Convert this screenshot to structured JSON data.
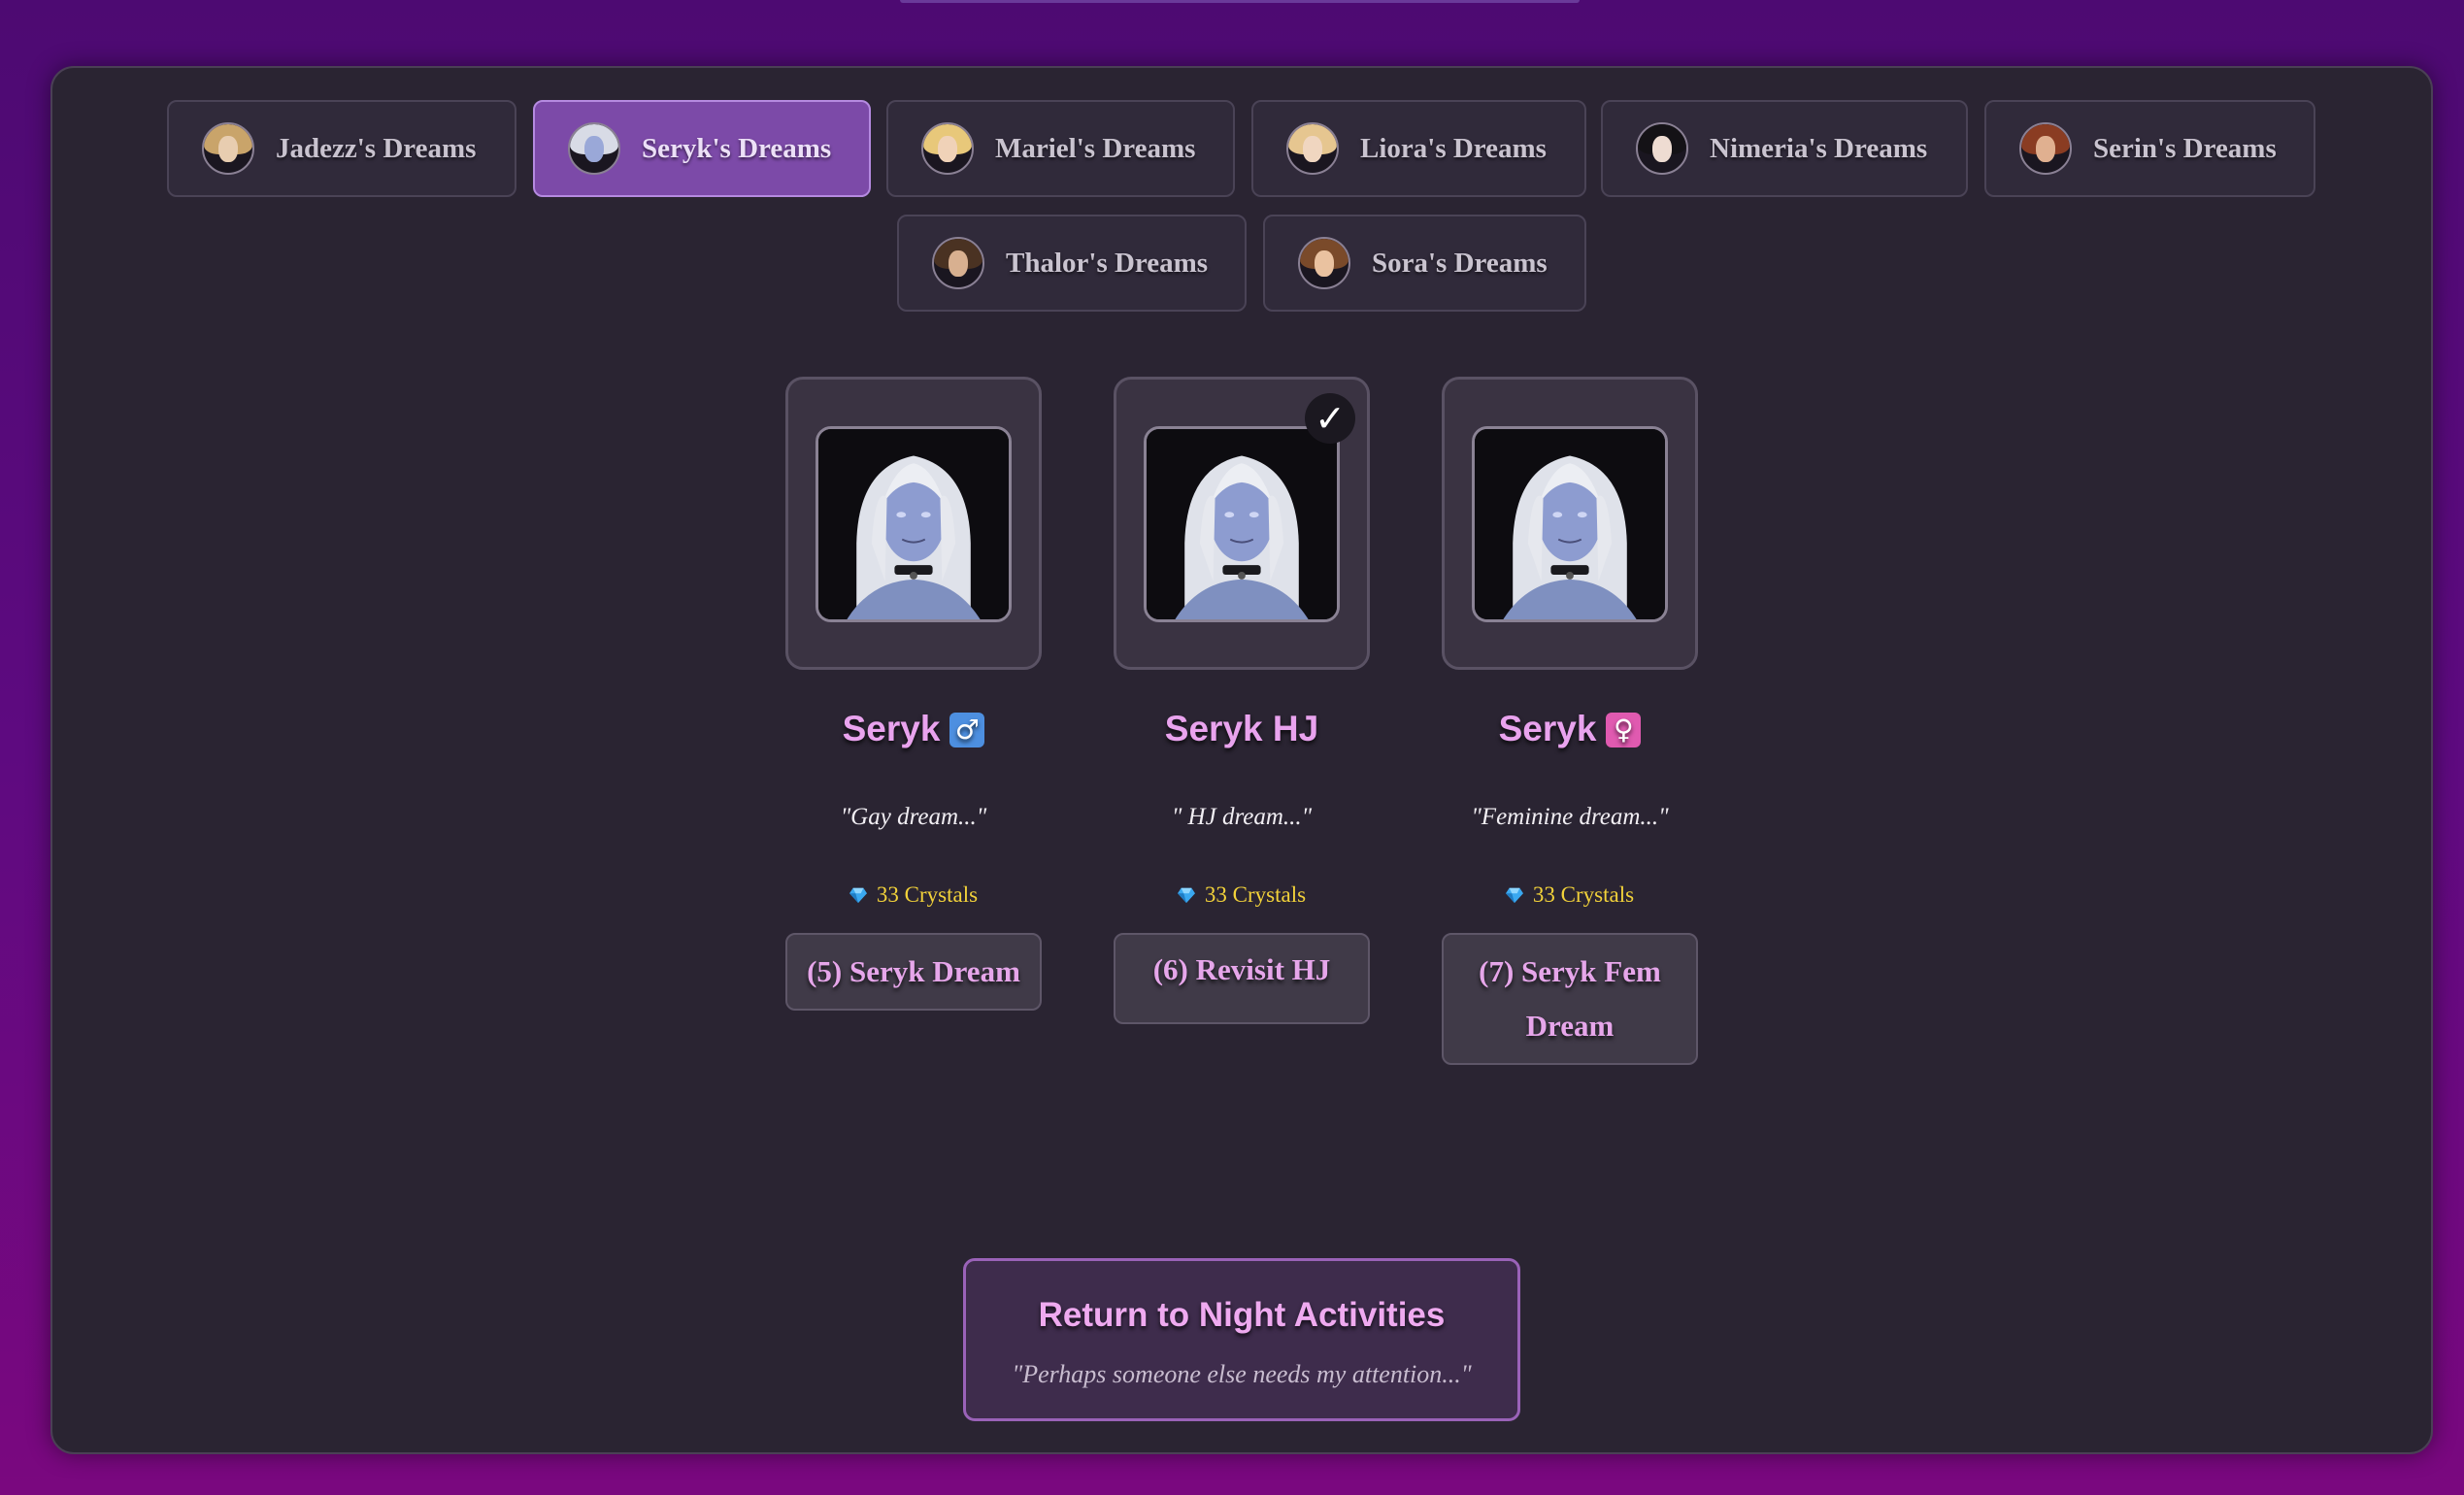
{
  "tabs": [
    {
      "label": "Jadezz's Dreams",
      "hair": "#c9a46a",
      "skin": "#e8cdb0",
      "active": false
    },
    {
      "label": "Seryk's Dreams",
      "hair": "#d8dbe6",
      "skin": "#9aa8d8",
      "active": true
    },
    {
      "label": "Mariel's Dreams",
      "hair": "#e8c87a",
      "skin": "#f0d2b8",
      "active": false
    },
    {
      "label": "Liora's Dreams",
      "hair": "#e6c690",
      "skin": "#f0d6c0",
      "active": false
    },
    {
      "label": "Nimeria's Dreams",
      "hair": "#141216",
      "skin": "#eedcd2",
      "active": false
    },
    {
      "label": "Serin's Dreams",
      "hair": "#8a3c22",
      "skin": "#e0b090",
      "active": false
    },
    {
      "label": "Thalor's Dreams",
      "hair": "#4a3222",
      "skin": "#d8b090",
      "active": false
    },
    {
      "label": "Sora's Dreams",
      "hair": "#7a4a2a",
      "skin": "#eac2a0",
      "active": false
    }
  ],
  "dreams": [
    {
      "name": "Seryk",
      "gender_symbol": "♂",
      "quote": "\"Gay dream...\"",
      "cost": "33 Crystals",
      "action_label": "(5) Seryk Dream",
      "completed": false
    },
    {
      "name": "Seryk HJ",
      "gender_symbol": "",
      "quote": "\" HJ dream...\"",
      "cost": "33 Crystals",
      "action_label": "(6) Revisit HJ",
      "completed": true,
      "check_symbol": "✓"
    },
    {
      "name": "Seryk",
      "gender_symbol": "♀",
      "quote": "\"Feminine dream...\"",
      "cost": "33 Crystals",
      "action_label": "(7) Seryk Fem Dream",
      "completed": false
    }
  ],
  "return_button": {
    "title": "Return to Night Activities",
    "subtitle": "\"Perhaps someone else needs my attention...\""
  },
  "colors": {
    "accent_pink": "#e9a3ee",
    "crystal_gold": "#f2d23a",
    "active_tab": "#7c4aa8",
    "panel": "#2a2432",
    "male_badge": "#4d8fe0",
    "female_badge": "#e05ab0"
  },
  "icons": {
    "crystal": "gem-icon",
    "completed": "checkmark-icon",
    "male": "male-symbol-icon",
    "female": "female-symbol-icon"
  }
}
